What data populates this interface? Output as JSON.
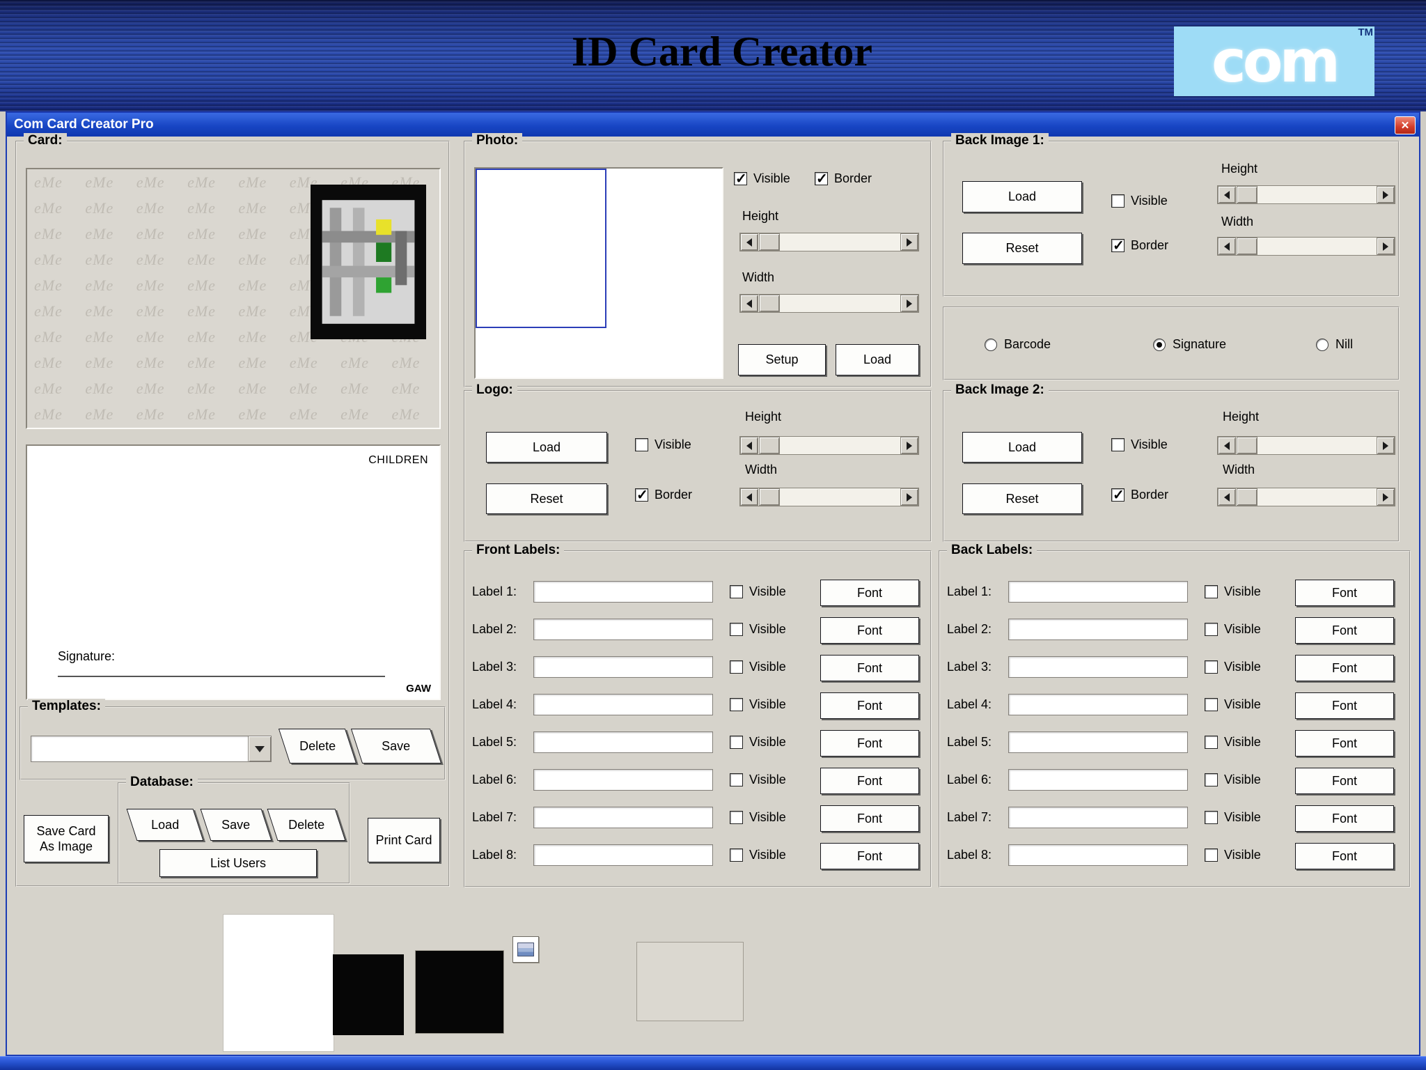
{
  "colors": {
    "window_bg": "#d6d3cb",
    "titlebar_blue": "#1846c4",
    "banner_blue": "#2c4cae",
    "logo_bg": "#9edcf6",
    "close_red": "#d23c2a",
    "photo_frame_blue": "#2b3db8"
  },
  "banner": {
    "title": "ID Card Creator",
    "logo_text": "com",
    "logo_tm": "TM"
  },
  "window": {
    "title": "Com Card Creator Pro",
    "close_glyph": "✕"
  },
  "card": {
    "group_label": "Card:",
    "watermark_text": "eMe",
    "watermark_rows": 10,
    "watermark_cols": 8,
    "children_label": "CHILDREN",
    "signature_label": "Signature:",
    "gaw_label": "GAW",
    "templates": {
      "group_label": "Templates:",
      "dropdown_value": "",
      "delete_label": "Delete",
      "save_label": "Save"
    },
    "database": {
      "group_label": "Database:",
      "load_label": "Load",
      "save_label": "Save",
      "delete_label": "Delete",
      "list_users_label": "List Users"
    },
    "save_card_lines": [
      "Save Card",
      "As Image"
    ],
    "print_card_label": "Print Card"
  },
  "photo": {
    "group_label": "Photo:",
    "visible": {
      "label": "Visible",
      "checked": true
    },
    "border": {
      "label": "Border",
      "checked": true
    },
    "height_label": "Height",
    "width_label": "Width",
    "setup_label": "Setup",
    "load_label": "Load"
  },
  "logo": {
    "group_label": "Logo:",
    "load_label": "Load",
    "reset_label": "Reset",
    "visible": {
      "label": "Visible",
      "checked": false
    },
    "border": {
      "label": "Border",
      "checked": true
    },
    "height_label": "Height",
    "width_label": "Width"
  },
  "front_labels": {
    "group_label": "Front Labels:",
    "visible_label": "Visible",
    "font_label": "Font",
    "rows": [
      {
        "label": "Label 1:",
        "value": ""
      },
      {
        "label": "Label 2:",
        "value": ""
      },
      {
        "label": "Label 3:",
        "value": ""
      },
      {
        "label": "Label 4:",
        "value": ""
      },
      {
        "label": "Label 5:",
        "value": ""
      },
      {
        "label": "Label 6:",
        "value": ""
      },
      {
        "label": "Label 7:",
        "value": ""
      },
      {
        "label": "Label 8:",
        "value": ""
      }
    ]
  },
  "back_image_1": {
    "group_label": "Back Image 1:",
    "load_label": "Load",
    "reset_label": "Reset",
    "visible": {
      "label": "Visible",
      "checked": false
    },
    "border": {
      "label": "Border",
      "checked": true
    },
    "height_label": "Height",
    "width_label": "Width"
  },
  "back_options": {
    "items": [
      {
        "label": "Barcode",
        "selected": false
      },
      {
        "label": "Signature",
        "selected": true
      },
      {
        "label": "Nill",
        "selected": false
      }
    ]
  },
  "back_image_2": {
    "group_label": "Back Image 2:",
    "load_label": "Load",
    "reset_label": "Reset",
    "visible": {
      "label": "Visible",
      "checked": false
    },
    "border": {
      "label": "Border",
      "checked": true
    },
    "height_label": "Height",
    "width_label": "Width"
  },
  "back_labels": {
    "group_label": "Back Labels:",
    "visible_label": "Visible",
    "font_label": "Font",
    "rows": [
      {
        "label": "Label 1:",
        "value": ""
      },
      {
        "label": "Label 2:",
        "value": ""
      },
      {
        "label": "Label 3:",
        "value": ""
      },
      {
        "label": "Label 4:",
        "value": ""
      },
      {
        "label": "Label 5:",
        "value": ""
      },
      {
        "label": "Label 6:",
        "value": ""
      },
      {
        "label": "Label 7:",
        "value": ""
      },
      {
        "label": "Label 8:",
        "value": ""
      }
    ]
  }
}
